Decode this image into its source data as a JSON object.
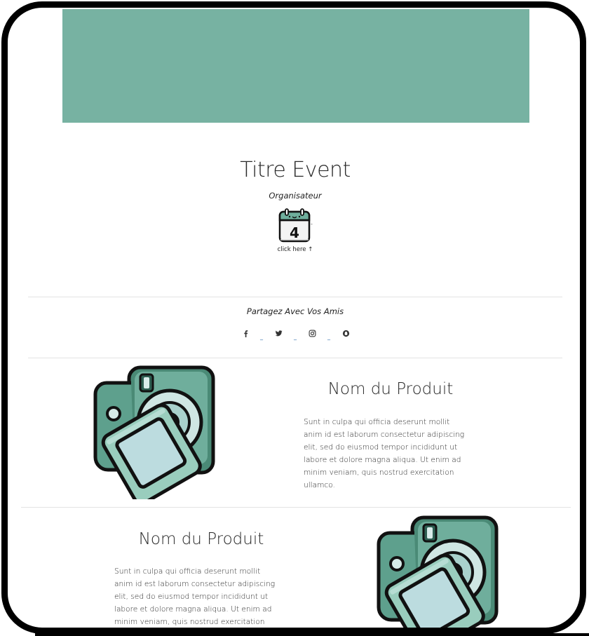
{
  "colors": {
    "banner": "#77b2a2",
    "accent": "#6fae9c",
    "frame": "#000000"
  },
  "event": {
    "title": "Titre Event",
    "organizer": "Organisateur",
    "calendar_day": "4",
    "click_here": "click here ↑"
  },
  "share": {
    "title": "Partagez Avec Vos Amis",
    "icons": [
      "facebook-icon",
      "twitter-icon",
      "instagram-icon",
      "snapchat-icon"
    ]
  },
  "products": [
    {
      "name": "Nom du Produit",
      "description": "Sunt in culpa qui officia deserunt mollit anim id est laborum consectetur adipiscing elit, sed do eiusmod tempor incididunt ut labore et dolore magna aliqua. Ut enim ad minim veniam, quis nostrud exercitation ullamco.",
      "image": "camera-icon"
    },
    {
      "name": "Nom du Produit",
      "description": "Sunt in culpa qui officia deserunt mollit anim id est laborum consectetur adipiscing elit, sed do eiusmod tempor incididunt ut labore et dolore magna aliqua. Ut enim ad minim veniam, quis nostrud exercitation ullamco.",
      "image": "camera-icon"
    }
  ]
}
